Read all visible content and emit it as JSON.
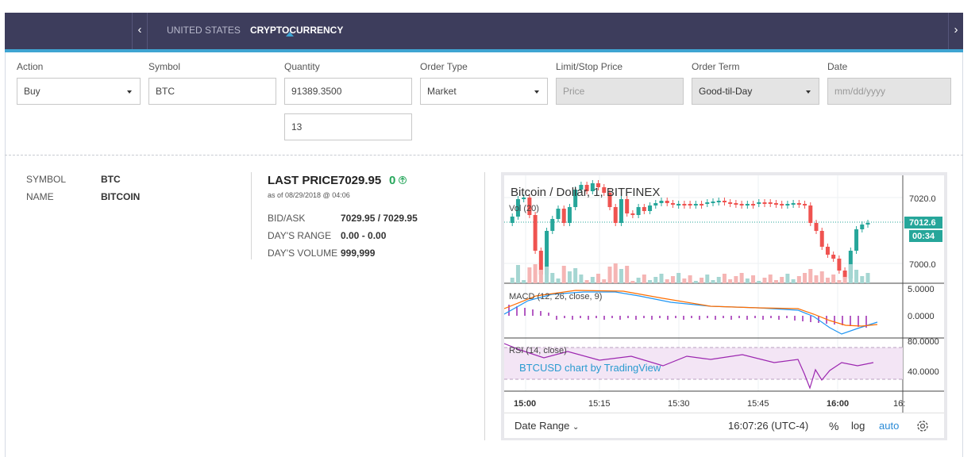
{
  "tabs": [
    {
      "label": "UNITED STATES",
      "active": false
    },
    {
      "label": "CRYPTOCURRENCY",
      "active": true
    }
  ],
  "form": {
    "action": {
      "label": "Action",
      "value": "Buy"
    },
    "symbol": {
      "label": "Symbol",
      "value": "BTC"
    },
    "quantity": {
      "label": "Quantity",
      "value": "91389.3500",
      "secondary_value": "13"
    },
    "order_type": {
      "label": "Order Type",
      "value": "Market"
    },
    "limit_stop": {
      "label": "Limit/Stop Price",
      "placeholder": "Price"
    },
    "order_term": {
      "label": "Order Term",
      "value": "Good-til-Day"
    },
    "date": {
      "label": "Date",
      "placeholder": "mm/dd/yyyy"
    }
  },
  "quote": {
    "symbol_label": "SYMBOL",
    "symbol_value": "BTC",
    "name_label": "NAME",
    "name_value": "BITCOIN",
    "last_price_label": "LAST PRICE",
    "last_price": "7029.95",
    "change": "0",
    "as_of": "as of 08/29/2018 @ 04:06",
    "bid_ask_label": "BID/ASK",
    "bid_ask": "7029.95 / 7029.95",
    "days_range_label": "DAY'S RANGE",
    "days_range": "0.00 - 0.00",
    "days_volume_label": "DAY'S VOLUME",
    "days_volume": "999,999"
  },
  "chart": {
    "title": "Bitcoin / Dollar, 1, BITFINEX",
    "vol_label": "Vol (20)",
    "macd_label": "MACD (12, 26, close, 9)",
    "rsi_label": "RSI (14, close)",
    "watermark": "BTCUSD chart by TradingView",
    "price_ticks": [
      "7020.0",
      "7000.0"
    ],
    "last_price_tag": "7012.6",
    "countdown_tag": "00:34",
    "macd_ticks": [
      "5.0000",
      "0.0000"
    ],
    "rsi_ticks": [
      "80.0000",
      "40.0000"
    ],
    "time_ticks": [
      "15:00",
      "15:15",
      "15:30",
      "15:45",
      "16:00",
      "16:"
    ],
    "date_range_label": "Date Range",
    "clock": "16:07:26 (UTC-4)",
    "percent_label": "%",
    "log_label": "log",
    "auto_label": "auto",
    "colors": {
      "up": "#26a69a",
      "down": "#ef5350",
      "macd": "#2196f3",
      "signal": "#ff6d00",
      "hist": "#9c27b0",
      "rsi": "#9c27b0",
      "rsi_band": "#f3e5f5"
    }
  }
}
